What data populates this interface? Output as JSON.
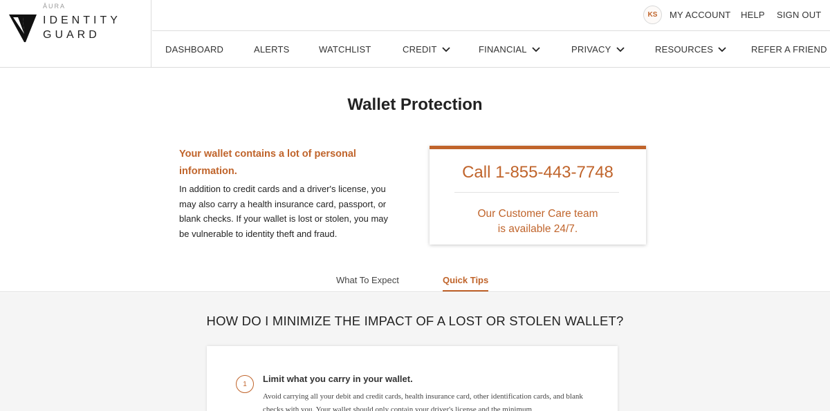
{
  "logo": {
    "aura": "ĀURA",
    "line1": "IDENTITY",
    "line2": "GUARD"
  },
  "topbar": {
    "avatar_initials": "KS",
    "my_account": "MY ACCOUNT",
    "help": "HELP",
    "sign_out": "SIGN OUT"
  },
  "nav": {
    "dashboard": "DASHBOARD",
    "alerts": "ALERTS",
    "watchlist": "WATCHLIST",
    "credit": "CREDIT",
    "financial": "FINANCIAL",
    "privacy": "PRIVACY",
    "resources": "RESOURCES",
    "refer": "REFER A FRIEND"
  },
  "page": {
    "title": "Wallet Protection"
  },
  "intro": {
    "headline": "Your wallet contains a lot of personal information.",
    "body": "In addition to credit cards and a driver's license, you may also carry a health insurance card, passport, or blank checks. If your wallet is lost or stolen, you may be vulnerable to identity theft and fraud."
  },
  "callbox": {
    "phone": "Call 1-855-443-7748",
    "line1": "Our Customer Care team",
    "line2": "is available 24/7."
  },
  "tabs": {
    "what_to_expect": "What To Expect",
    "quick_tips": "Quick Tips",
    "active": "Quick Tips"
  },
  "section": {
    "title": "HOW DO I MINIMIZE THE IMPACT OF A LOST OR STOLEN WALLET?"
  },
  "tips": [
    {
      "number": "1",
      "title": "Limit what you carry in your wallet.",
      "body": "Avoid carrying all your debit and credit cards, health insurance card, other identification cards, and blank checks with you. Your wallet should only contain your driver's license and the minimum"
    }
  ],
  "colors": {
    "accent": "#c0642b",
    "section_bg": "#f5f5f5"
  }
}
